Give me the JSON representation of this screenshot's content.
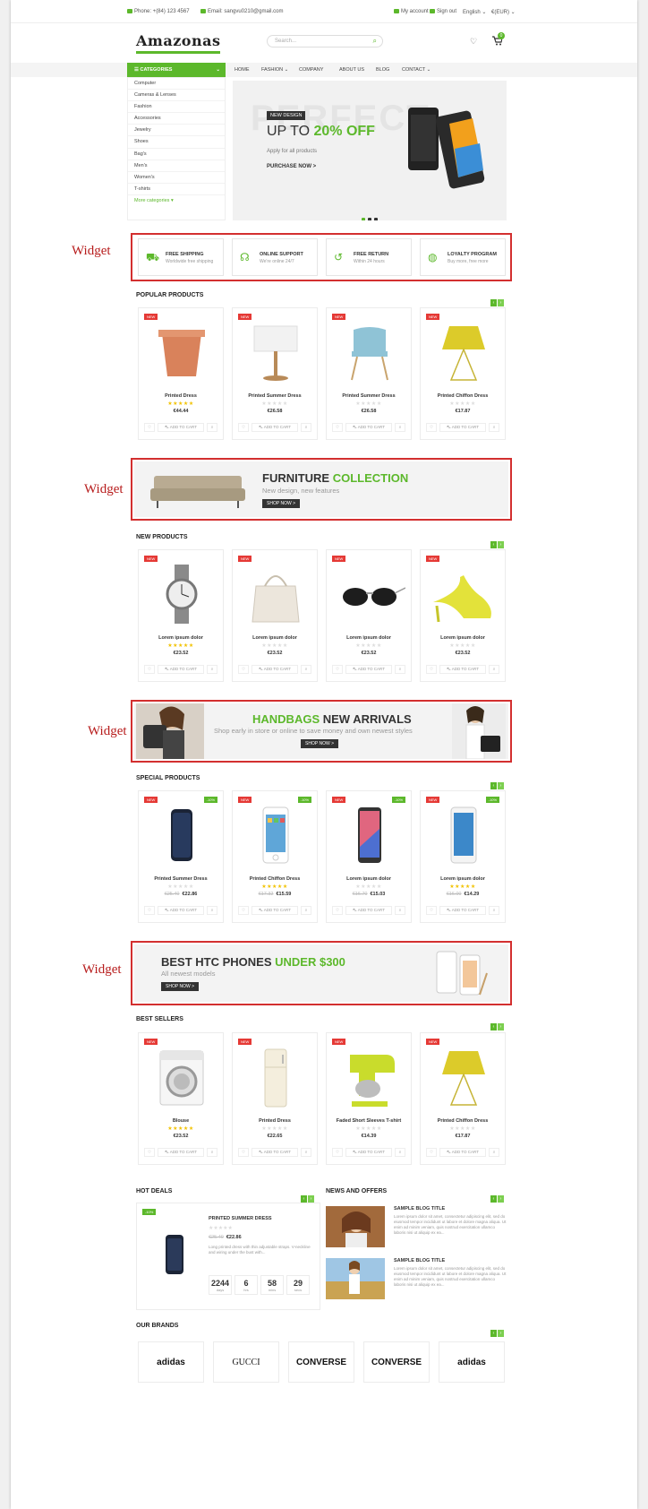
{
  "topbar": {
    "phone": "Phone: +(84) 123 4567",
    "email": "Email: sangvu0210@gmail.com",
    "account": "My account",
    "signout": "Sign out",
    "language": "English ⌄",
    "currency": "€(EUR) ⌄"
  },
  "header": {
    "logo": "Amazonas",
    "search_placeholder": "Search...",
    "cart_count": "0"
  },
  "nav": {
    "categories_label": "CATEGORIES",
    "items": [
      "HOME",
      "FASHION ⌄",
      "COMPANY",
      "ABOUT US",
      "BLOG",
      "CONTACT ⌄"
    ]
  },
  "categories": [
    "Computer",
    "Cameras & Lenses",
    "Fashion",
    "Accessories",
    "Jewelry",
    "Shoes",
    "Bag's",
    "Men's",
    "Women's",
    "T-shirts",
    "More categories ▾"
  ],
  "hero": {
    "bg_text": "PERFECT",
    "tag": "NEW DESIGN",
    "headline_1": "UP TO ",
    "headline_2": "20% OFF",
    "sub": "Apply for all products",
    "cta": "PURCHASE NOW >"
  },
  "widget_label": "Widget",
  "features": [
    {
      "title": "FREE SHIPPING",
      "sub": "Worldwide free shipping",
      "icon": "truck-icon"
    },
    {
      "title": "ONLINE SUPPORT",
      "sub": "We're online 24/7",
      "icon": "headset-icon"
    },
    {
      "title": "FREE RETURN",
      "sub": "Within 24 hours",
      "icon": "return-icon"
    },
    {
      "title": "LOYALTY PROGRAM",
      "sub": "Buy more, free more",
      "icon": "globe-icon"
    }
  ],
  "sections": {
    "popular": "POPULAR PRODUCTS",
    "new": "NEW PRODUCTS",
    "special": "SPECIAL PRODUCTS",
    "best": "BEST SELLERS",
    "hot": "HOT DEALS",
    "news": "NEWS AND OFFERS",
    "brands": "OUR BRANDS"
  },
  "labels": {
    "new": "NEW",
    "sale": "-10%",
    "add_to_cart": "ADD TO CART"
  },
  "popular": [
    {
      "name": "Printed Dress",
      "price": "€44.44",
      "rated": true
    },
    {
      "name": "Printed Summer Dress",
      "price": "€26.58",
      "rated": false
    },
    {
      "name": "Printed Summer Dress",
      "price": "€26.58",
      "rated": false
    },
    {
      "name": "Printed Chiffon Dress",
      "price": "€17.87",
      "rated": false
    }
  ],
  "newp": [
    {
      "name": "Lorem ipsum dolor",
      "price": "€23.52",
      "rated": true
    },
    {
      "name": "Lorem ipsum dolor",
      "price": "€23.52",
      "rated": false
    },
    {
      "name": "Lorem ipsum dolor",
      "price": "€23.52",
      "rated": false
    },
    {
      "name": "Lorem ipsum dolor",
      "price": "€23.52",
      "rated": false
    }
  ],
  "special": [
    {
      "name": "Printed Summer Dress",
      "old": "€25.40",
      "price": "€22.86",
      "rated": false
    },
    {
      "name": "Printed Chiffon Dress",
      "old": "€17.32",
      "price": "€15.59",
      "rated": true
    },
    {
      "name": "Lorem ipsum dolor",
      "old": "€16.70",
      "price": "€15.03",
      "rated": false
    },
    {
      "name": "Lorem ipsum dolor",
      "old": "€16.00",
      "price": "€14.29",
      "rated": true
    }
  ],
  "best": [
    {
      "name": "Blouse",
      "price": "€23.52",
      "rated": true
    },
    {
      "name": "Printed Dress",
      "price": "€22.65",
      "rated": false
    },
    {
      "name": "Faded Short Sleeves T-shirt",
      "price": "€14.39",
      "rated": false
    },
    {
      "name": "Printed Chiffon Dress",
      "price": "€17.87",
      "rated": false
    }
  ],
  "banners": {
    "furniture": {
      "h1": "FURNITURE ",
      "h2": "COLLECTION",
      "p": "New design, new features",
      "btn": "SHOP NOW >"
    },
    "handbags": {
      "h1": "HANDBAGS ",
      "h2": "NEW ARRIVALS",
      "p": "Shop early in store or online to save money and own newest styles",
      "btn": "SHOP NOW >"
    },
    "phones": {
      "h1": "BEST HTC PHONES ",
      "h2": "UNDER $300",
      "p": "All newest models",
      "btn": "SHOP NOW >"
    }
  },
  "deal": {
    "name": "PRINTED SUMMER DRESS",
    "old": "€25.40",
    "price": "€22.86",
    "desc": "Long printed dress with thin adjustable straps. V-neckline and wiring under the bust with...",
    "countdown": [
      {
        "v": "2244",
        "u": "days"
      },
      {
        "v": "6",
        "u": "hrs"
      },
      {
        "v": "58",
        "u": "mins"
      },
      {
        "v": "29",
        "u": "secs"
      }
    ]
  },
  "news": [
    {
      "title": "SAMPLE BLOG TITLE",
      "desc": "Lorem ipsum dolor sit amet, consectetur adipiscing elit, sed do eiusmod tempor incididunt ut labore et dolore magna aliqua. Ut enim ad minim veniam, quis nostrud exercitation ullamco laboris nisi ut aliquip ex ea..."
    },
    {
      "title": "SAMPLE BLOG TITLE",
      "desc": "Lorem ipsum dolor sit amet, consectetur adipiscing elit, sed do eiusmod tempor incididunt ut labore et dolore magna aliqua. Ut enim ad minim veniam, quis nostrud exercitation ullamco laboris nisi ut aliquip ex ea..."
    }
  ],
  "brands": [
    "adidas",
    "GUCCI",
    "CONVERSE",
    "CONVERSE",
    "adidas"
  ],
  "colors": {
    "accent": "#5cb82b",
    "new_badge": "#e53935",
    "widget_outline": "#d32f2f"
  }
}
